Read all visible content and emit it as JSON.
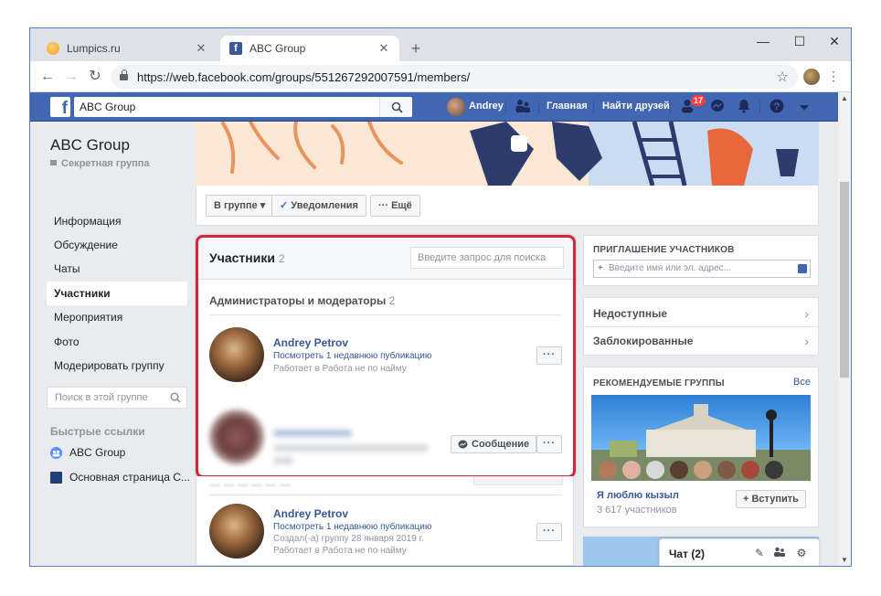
{
  "browser": {
    "tabs": [
      {
        "title": "Lumpics.ru",
        "active": false
      },
      {
        "title": "ABC Group",
        "active": true
      }
    ],
    "url": "https://web.facebook.com/groups/551267292007591/members/",
    "window_controls": [
      "—",
      "☐",
      "✕"
    ]
  },
  "fb_header": {
    "search_value": "ABC Group",
    "user_name": "Andrey",
    "home_label": "Главная",
    "find_friends_label": "Найти друзей",
    "friend_requests_count": "17"
  },
  "left_nav": {
    "group_name": "ABC Group",
    "group_type": "Секретная группа",
    "items": [
      {
        "label": "Информация",
        "active": false
      },
      {
        "label": "Обсуждение",
        "active": false
      },
      {
        "label": "Чаты",
        "active": false
      },
      {
        "label": "Участники",
        "active": true
      },
      {
        "label": "Мероприятия",
        "active": false
      },
      {
        "label": "Фото",
        "active": false
      },
      {
        "label": "Модерировать группу",
        "active": false
      }
    ],
    "search_placeholder": "Поиск в этой группе",
    "quick_links_title": "Быстрые ссылки",
    "quick_links": [
      "ABC Group",
      "Основная страница С..."
    ]
  },
  "action_bar": {
    "in_group_label": "В группе",
    "notifications_label": "Уведомления",
    "more_label": "Ещё"
  },
  "members": {
    "title": "Участники",
    "count": "2",
    "search_placeholder": "Введите запрос для поиска",
    "admins_title": "Администраторы и модераторы",
    "admins_count": "2",
    "admin1": {
      "name": "Andrey Petrov",
      "line1": "Посмотреть 1 недавнюю публикацию",
      "line2": "Работает в Работа не по найму"
    },
    "message_label": "Сообщение",
    "more_dots": "···",
    "member1": {
      "name": "Andrey Petrov",
      "line1": "Посмотреть 1 недавнюю публикацию",
      "line2": "Создал(-а) группу 28 января 2019 г.",
      "line3": "Работает в Работа не по найму"
    }
  },
  "right_col": {
    "invite_title": "ПРИГЛАШЕНИЕ УЧАСТНИКОВ",
    "invite_placeholder": "Введите имя или эл. адрес...",
    "unavailable_label": "Недоступные",
    "blocked_label": "Заблокированные",
    "recommended_title": "РЕКОМЕНДУЕМЫЕ ГРУППЫ",
    "all_label": "Все",
    "rec_group_name": "Я люблю кызыл",
    "rec_group_members": "3 617 участников",
    "join_label": "+ Вступить"
  },
  "chat": {
    "label": "Чат (2)"
  },
  "colors": {
    "fb_blue": "#4267b2",
    "link_blue": "#365899",
    "highlight_red": "#d2263b"
  }
}
